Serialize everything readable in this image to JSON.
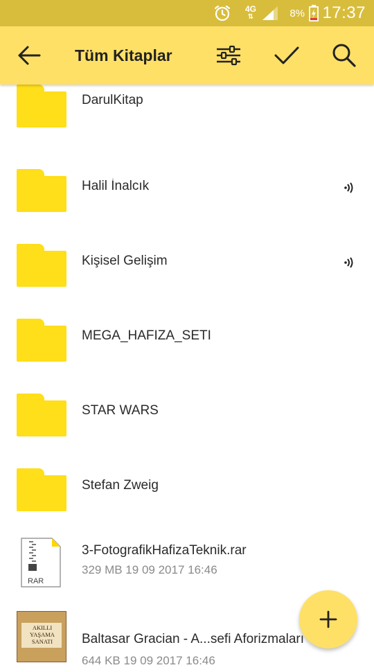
{
  "status_bar": {
    "network": "4G",
    "battery_percent": "8%",
    "clock": "17:37",
    "icons": [
      "alarm-icon",
      "network-4g-icon",
      "signal-icon",
      "battery-charging-icon"
    ]
  },
  "toolbar": {
    "title": "Tüm Kitaplar",
    "icons": [
      "back-arrow-icon",
      "filter-sliders-icon",
      "checkmark-icon",
      "search-icon"
    ]
  },
  "folders": [
    {
      "name": "DarulKitap",
      "synced": false
    },
    {
      "name": "Halil İnalcık",
      "synced": true
    },
    {
      "name": "Kişisel Gelişim",
      "synced": true
    },
    {
      "name": "MEGA_HAFIZA_SETI",
      "synced": false
    },
    {
      "name": "STAR WARS",
      "synced": false
    },
    {
      "name": "Stefan Zweig",
      "synced": false
    }
  ],
  "files": [
    {
      "name": "3-FotografikHafizaTeknik.rar",
      "meta": "329 MB 19 09 2017 16:46",
      "icon": "rar-file-icon",
      "icon_label": "RAR"
    },
    {
      "name": "Baltasar Gracian - A...sefi Aforizmaları",
      "meta": "644 KB 19 09 2017 16:46",
      "icon": "book-cover-thumbnail",
      "cover_lines": [
        "AKILLI",
        "YAŞAMA",
        "SANATI"
      ]
    }
  ],
  "fab": {
    "icon": "plus-icon"
  },
  "colors": {
    "status_bar": "#d8bd3c",
    "toolbar": "#ffe066",
    "folder": "#ffde1a",
    "meta_text": "#8a8a8a"
  }
}
